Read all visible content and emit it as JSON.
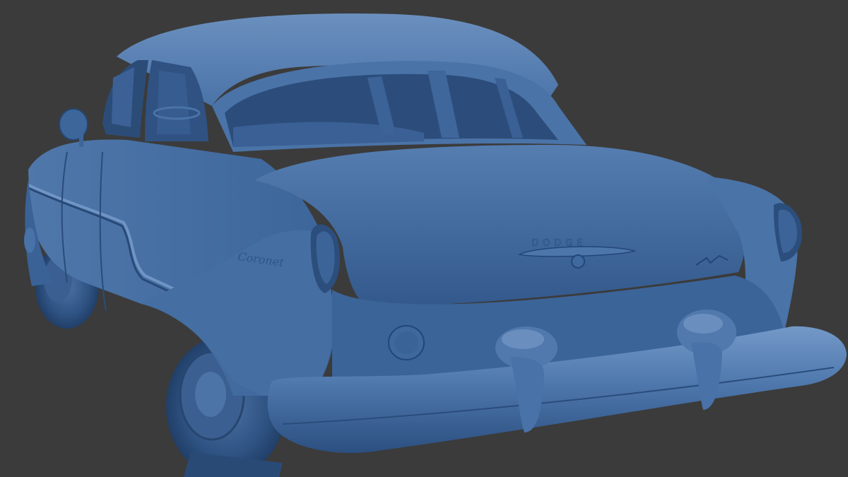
{
  "scene": {
    "background_color": "#3b3b3b",
    "body_color": "#3f6aa0",
    "shadow_color": "#1f3d66",
    "highlight_color": "#6f95c4"
  },
  "emblems": {
    "brand": "DODGE",
    "model_script": "Coronet"
  }
}
